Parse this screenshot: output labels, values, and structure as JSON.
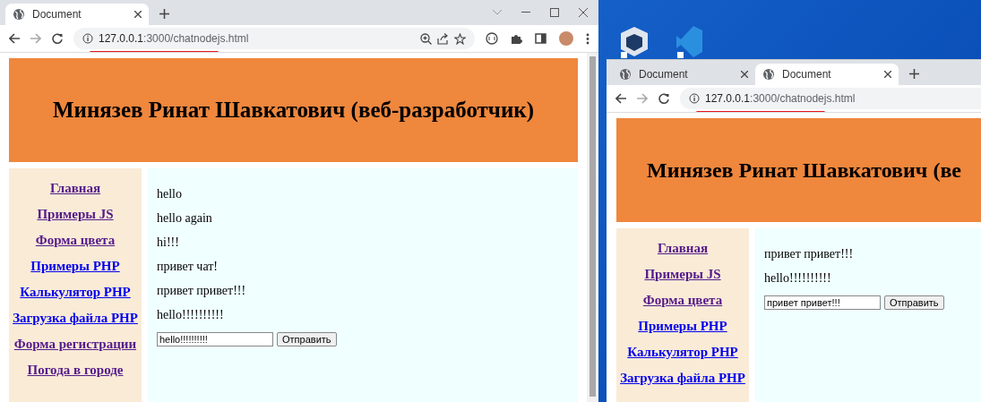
{
  "windows": [
    {
      "controls_shown": true,
      "tabs": [
        {
          "title": "Document",
          "selected": true
        }
      ],
      "url_host": "127.0.0.1",
      "url_path": ":3000/chatnodejs.html",
      "page": {
        "heading": "Минязев Ринат Шавкатович (веб-разработчик)",
        "heading_cut": false,
        "nav": [
          {
            "label": "Главная",
            "visited": true
          },
          {
            "label": "Примеры JS",
            "visited": true
          },
          {
            "label": "Форма цвета",
            "visited": true
          },
          {
            "label": "Примеры PHP",
            "visited": false
          },
          {
            "label": "Калькулятор PHP",
            "visited": false
          },
          {
            "label": "Загрузка файла PHP",
            "visited": false
          },
          {
            "label": "Форма регистрации",
            "visited": true
          },
          {
            "label": "Погода в городе",
            "visited": true
          }
        ],
        "messages": [
          "hello",
          "hello again",
          "hi!!!",
          "привет чат!",
          "привет привет!!!",
          "hello!!!!!!!!!!"
        ],
        "input_value": "hello!!!!!!!!!!",
        "send_button": "Отправить"
      }
    },
    {
      "controls_shown": false,
      "tabs": [
        {
          "title": "Document",
          "selected": false
        },
        {
          "title": "Document",
          "selected": true
        }
      ],
      "url_host": "127.0.0.1",
      "url_path": ":3000/chatnodejs.html",
      "page": {
        "heading": "Минязев Ринат Шавкатович (ве",
        "heading_cut": true,
        "nav": [
          {
            "label": "Главная",
            "visited": true
          },
          {
            "label": "Примеры JS",
            "visited": true
          },
          {
            "label": "Форма цвета",
            "visited": true
          },
          {
            "label": "Примеры PHP",
            "visited": false
          },
          {
            "label": "Калькулятор PHP",
            "visited": false
          },
          {
            "label": "Загрузка файла PHP",
            "visited": false
          }
        ],
        "messages": [
          "привет привет!!!",
          "hello!!!!!!!!!!"
        ],
        "input_value": "привет привет!!!",
        "send_button": "Отправить"
      }
    }
  ]
}
